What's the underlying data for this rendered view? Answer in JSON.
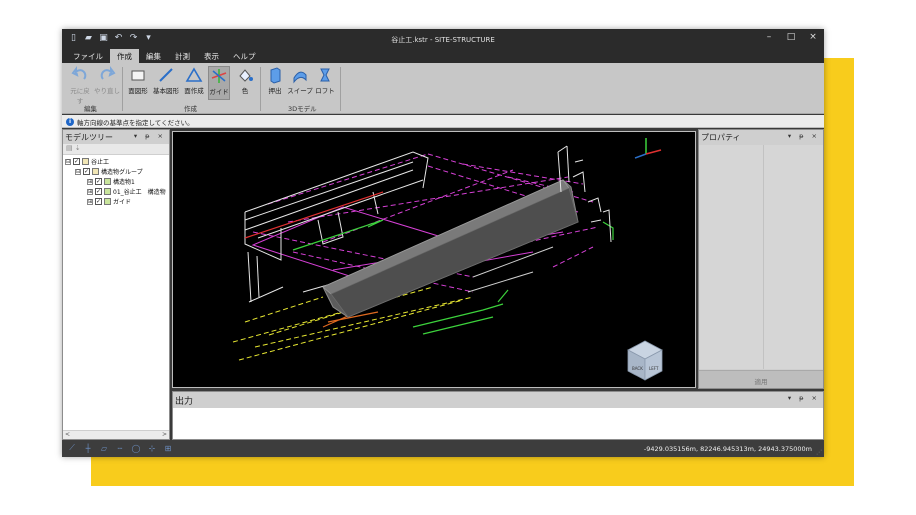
{
  "window": {
    "title": "谷止工.kstr - SITE-STRUCTURE",
    "controls": {
      "minimize": "–",
      "maximize": "□",
      "close": "×"
    }
  },
  "quick_access": [
    {
      "icon": "new-file-icon",
      "glyph": "▯"
    },
    {
      "icon": "open-folder-icon",
      "glyph": "▰"
    },
    {
      "icon": "save-icon",
      "glyph": "▣"
    },
    {
      "icon": "undo-icon",
      "glyph": "↶"
    },
    {
      "icon": "redo-icon",
      "glyph": "↷"
    },
    {
      "icon": "customize-icon",
      "glyph": "▾"
    }
  ],
  "menu": {
    "file": "ファイル",
    "create": "作成",
    "edit": "編集",
    "measure": "計測",
    "view": "表示",
    "help": "ヘルプ",
    "active": "create"
  },
  "ribbon": {
    "edit_group": {
      "label": "編集",
      "undo": "元に戻す",
      "redo": "やり直し"
    },
    "create_group": {
      "label": "作成",
      "face_shape": "面図形",
      "basic_shape": "基本図形",
      "face_create": "面作成",
      "guide": "ガイド",
      "color": "色"
    },
    "model3d_group": {
      "label": "3Dモデル",
      "extrude": "押出",
      "sweep": "スイープ",
      "loft": "ロフト"
    }
  },
  "status_message": "軸方向線の基準点を指定してください。",
  "model_tree": {
    "title": "モデルツリー",
    "header_buttons": "▾ ᵽ ×",
    "nodes": [
      {
        "label": "谷止工",
        "level": 0,
        "expander": "⊟"
      },
      {
        "label": "構造物グループ",
        "level": 1,
        "expander": "⊟"
      },
      {
        "label": "構造物1",
        "level": 2,
        "expander": "⊞"
      },
      {
        "label": "01_谷止工　構造物",
        "level": 2,
        "expander": "⊞"
      },
      {
        "label": "ガイド",
        "level": 2,
        "expander": "⊞"
      }
    ],
    "scroll_left": "<",
    "scroll_right": ">"
  },
  "properties": {
    "title": "プロパティ",
    "header_buttons": "▾ ᵽ ×",
    "apply": "適用"
  },
  "output": {
    "title": "出力",
    "header_buttons": "▾ ᵽ ×"
  },
  "view_cube": {
    "front": "BACK",
    "side": "LEFT"
  },
  "statusbar": {
    "coordinates": "-9429.035156m, 82246.945313m, 24943.375000m"
  },
  "colors": {
    "accent_yellow": "#f8cc1c",
    "viewport_bg": "#000000",
    "magenta_lines": "#d640d6",
    "yellow_lines": "#e8e832",
    "green_lines": "#3cd23c",
    "grey_structure": "#7a7a7a"
  }
}
